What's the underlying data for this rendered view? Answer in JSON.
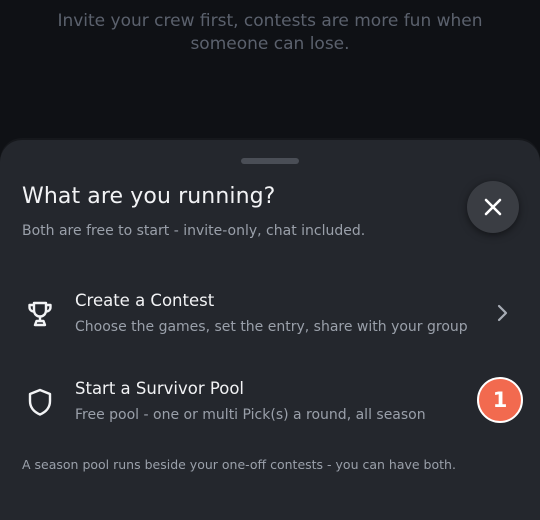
{
  "background": {
    "message": "Invite your crew first, contests are more fun when someone can lose."
  },
  "sheet": {
    "title": "What are you running?",
    "subtitle": "Both are free to start - invite-only, chat included.",
    "close_icon": "close-icon",
    "options": [
      {
        "icon": "trophy-icon",
        "title": "Create a Contest",
        "description": "Choose the games, set the entry, share with your group",
        "trailing_icon": "chevron-right-icon"
      },
      {
        "icon": "shield-icon",
        "title": "Start a Survivor Pool",
        "description": "Free pool - one or multi Pick(s) a round, all season",
        "badge": "1"
      }
    ],
    "footer_note": "A season pool runs beside your one-off contests - you can have both."
  },
  "colors": {
    "sheet_bg": "#24272d",
    "page_bg": "#0f1115",
    "badge_bg": "#f26a4f",
    "text_primary": "#f2f3f5",
    "text_secondary": "#9aa0aa"
  }
}
